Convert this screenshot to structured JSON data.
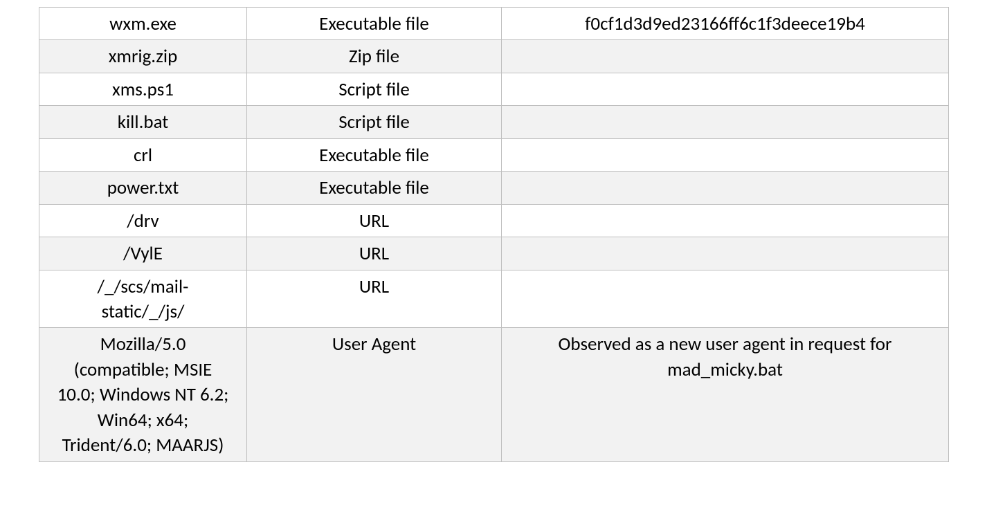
{
  "table": {
    "rows": [
      {
        "indicator": "wxm.exe",
        "type": "Executable file",
        "notes": "f0cf1d3d9ed23166ff6c1f3deece19b4"
      },
      {
        "indicator": "xmrig.zip",
        "type": "Zip file",
        "notes": ""
      },
      {
        "indicator": "xms.ps1",
        "type": "Script file",
        "notes": ""
      },
      {
        "indicator": "kill.bat",
        "type": "Script file",
        "notes": ""
      },
      {
        "indicator": "crl",
        "type": "Executable file",
        "notes": ""
      },
      {
        "indicator": "power.txt",
        "type": "Executable file",
        "notes": ""
      },
      {
        "indicator": "/drv",
        "type": "URL",
        "notes": ""
      },
      {
        "indicator": "/VylE",
        "type": "URL",
        "notes": ""
      },
      {
        "indicator": "/_/scs/mail-static/_/js/",
        "type": "URL",
        "notes": ""
      },
      {
        "indicator": "Mozilla/5.0 (compatible; MSIE 10.0; Windows NT 6.2; Win64; x64; Trident/6.0; MAARJS)",
        "type": "User Agent",
        "notes": "Observed as a new user agent in request for mad_micky.bat"
      }
    ]
  }
}
